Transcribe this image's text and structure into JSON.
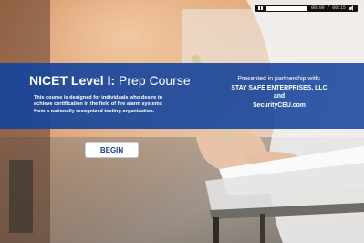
{
  "course": {
    "title_bold": "NICET Level I:",
    "title_rest": " Prep Course",
    "desc_line1": "This course is designed for individuals who desire to",
    "desc_line2": "achieve certification in the field of fire alarm systems",
    "desc_line3": "from a nationally recognized testing organization."
  },
  "partner": {
    "intro": "Presented in partnership with:",
    "company": "STAY SAFE ENTERPRISES, LLC",
    "and": "and",
    "site": "SecurityCEU.com"
  },
  "actions": {
    "begin_label": "BEGIN"
  },
  "player": {
    "time": "00:00 / 00:15",
    "progress_fraction": 0.0,
    "pause_icon": "pause-icon",
    "volume_icon": "volume-icon"
  },
  "colors": {
    "banner": "#16449b",
    "button_text": "#1b3f8f",
    "player_bg": "#111111"
  }
}
